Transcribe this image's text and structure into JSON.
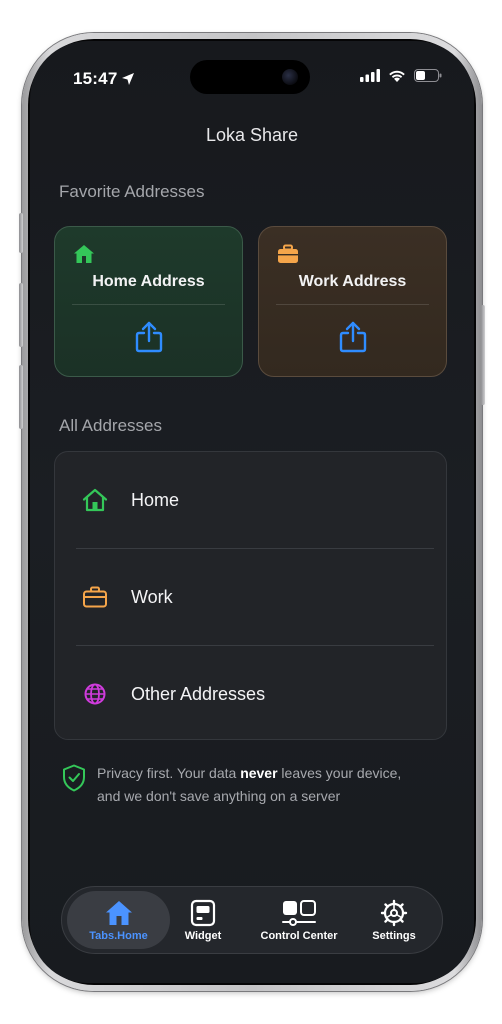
{
  "status_bar": {
    "time": "15:47"
  },
  "app": {
    "title": "Loka Share"
  },
  "favorites": {
    "section_title": "Favorite Addresses",
    "home": {
      "label": "Home Address",
      "icon": "house-icon",
      "accent": "#34c759"
    },
    "work": {
      "label": "Work Address",
      "icon": "briefcase-icon",
      "accent": "#f5a54a"
    },
    "share_icon": "share-icon",
    "share_color": "#2f8cff"
  },
  "all_addresses": {
    "section_title": "All Addresses",
    "items": [
      {
        "label": "Home",
        "icon": "house-icon",
        "color": "#34c759"
      },
      {
        "label": "Work",
        "icon": "briefcase-icon",
        "color": "#f5a54a"
      },
      {
        "label": "Other Addresses",
        "icon": "globe-icon",
        "color": "#cf3bdc"
      }
    ]
  },
  "privacy": {
    "text_before": "Privacy first. Your data ",
    "text_bold": "never",
    "text_after": " leaves your device,",
    "line2": "and we don't save anything on a server",
    "icon": "shield-check-icon",
    "color": "#34c759"
  },
  "tabbar": {
    "tabs": [
      {
        "label": "Tabs.Home",
        "icon": "house-icon",
        "active": true
      },
      {
        "label": "Widget",
        "icon": "widget-icon",
        "active": false
      },
      {
        "label": "Control Center",
        "icon": "control-center-icon",
        "active": false
      },
      {
        "label": "Settings",
        "icon": "gear-icon",
        "active": false
      }
    ],
    "active_color": "#4b93ff"
  }
}
